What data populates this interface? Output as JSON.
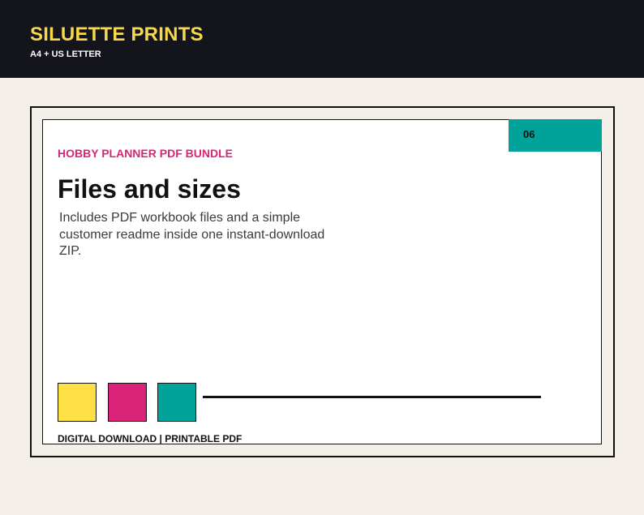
{
  "header": {
    "brand": "SILUETTE PRINTS",
    "subtitle": "A4 + US LETTER"
  },
  "card": {
    "page_number": "06",
    "eyebrow": "HOBBY PLANNER PDF BUNDLE",
    "title": "Files and sizes",
    "body": "Includes PDF workbook files and a simple customer readme inside one instant-download ZIP.",
    "footer": "DIGITAL DOWNLOAD | PRINTABLE PDF"
  },
  "palette": {
    "header_bg": "#14141c",
    "brand_yellow": "#f6d84a",
    "swatch_yellow": "#ffe044",
    "pink": "#d9247a",
    "teal": "#00a399",
    "page_bg": "#f4efe9"
  }
}
